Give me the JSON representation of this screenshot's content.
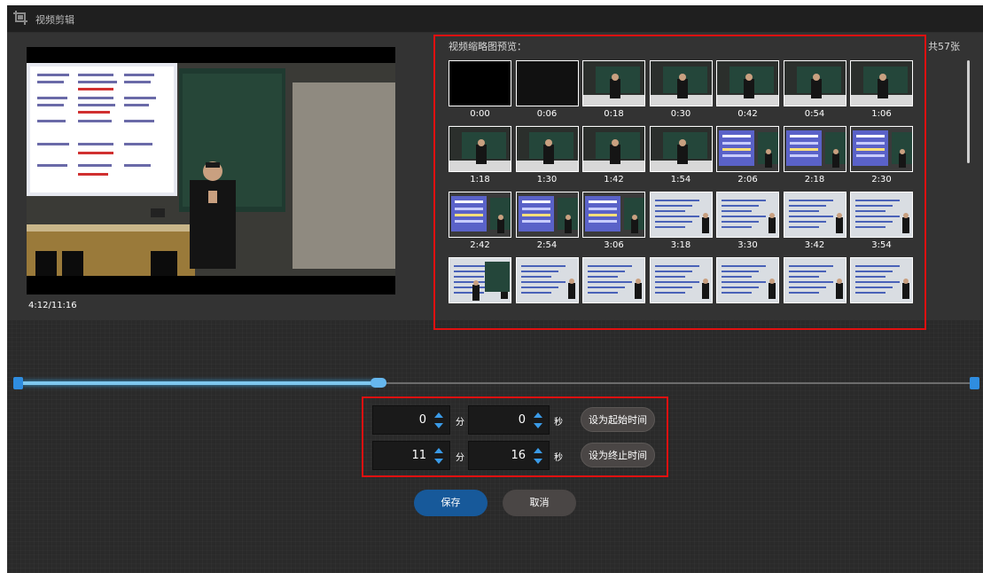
{
  "window": {
    "title": "视频剪辑"
  },
  "player": {
    "time": "4:12/11:16"
  },
  "thumbnails": {
    "title": "视频缩略图预览：",
    "count": "共57张",
    "items": [
      {
        "time": "0:00",
        "scene": "black"
      },
      {
        "time": "0:06",
        "scene": "dark"
      },
      {
        "time": "0:18",
        "scene": "board"
      },
      {
        "time": "0:30",
        "scene": "board"
      },
      {
        "time": "0:42",
        "scene": "board"
      },
      {
        "time": "0:54",
        "scene": "board"
      },
      {
        "time": "1:06",
        "scene": "board"
      },
      {
        "time": "1:18",
        "scene": "board"
      },
      {
        "time": "1:30",
        "scene": "board"
      },
      {
        "time": "1:42",
        "scene": "board"
      },
      {
        "time": "1:54",
        "scene": "board"
      },
      {
        "time": "2:06",
        "scene": "slide"
      },
      {
        "time": "2:18",
        "scene": "slide"
      },
      {
        "time": "2:30",
        "scene": "slide"
      },
      {
        "time": "2:42",
        "scene": "slide"
      },
      {
        "time": "2:54",
        "scene": "slide"
      },
      {
        "time": "3:06",
        "scene": "slide"
      },
      {
        "time": "3:18",
        "scene": "text"
      },
      {
        "time": "3:30",
        "scene": "text"
      },
      {
        "time": "3:42",
        "scene": "text"
      },
      {
        "time": "3:54",
        "scene": "text"
      },
      {
        "time": "",
        "scene": "textboard"
      },
      {
        "time": "",
        "scene": "text"
      },
      {
        "time": "",
        "scene": "text"
      },
      {
        "time": "",
        "scene": "text"
      },
      {
        "time": "",
        "scene": "text"
      },
      {
        "time": "",
        "scene": "text"
      },
      {
        "time": "",
        "scene": "text"
      }
    ]
  },
  "timeline": {
    "position_fraction": 0.373
  },
  "range": {
    "start": {
      "minutes": "0",
      "seconds": "0",
      "set_label": "设为起始时间"
    },
    "end": {
      "minutes": "11",
      "seconds": "16",
      "set_label": "设为终止时间"
    },
    "minute_unit": "分",
    "second_unit": "秒"
  },
  "actions": {
    "save": "保存",
    "cancel": "取消"
  },
  "colors": {
    "accent": "#2f8de0",
    "highlight_border": "#e01010",
    "save_button": "#17599a"
  }
}
